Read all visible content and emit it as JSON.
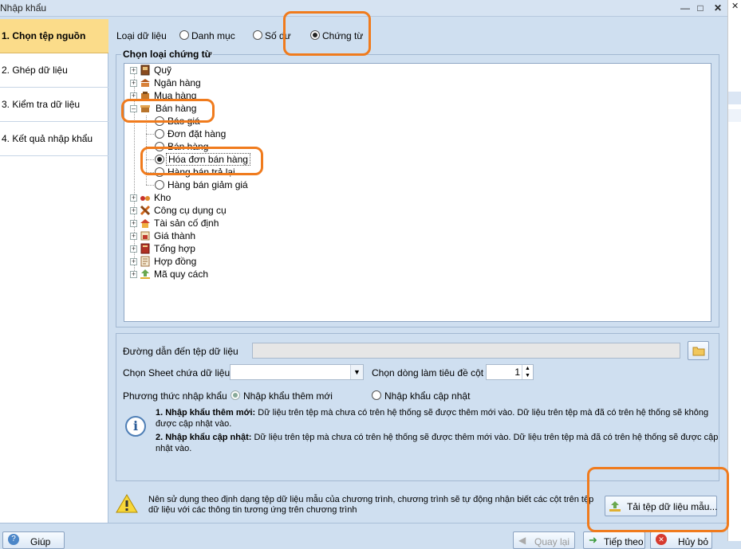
{
  "window": {
    "title": "Nhập khẩu"
  },
  "steps": [
    "1. Chọn tệp nguồn",
    "2. Ghép dữ liệu",
    "3. Kiểm tra dữ liệu",
    "4. Kết quả nhập khẩu"
  ],
  "data_type": {
    "label": "Loại dữ liệu",
    "options": [
      {
        "label": "Danh mục",
        "checked": false
      },
      {
        "label": "Số dư",
        "checked": false
      },
      {
        "label": "Chứng từ",
        "checked": true
      }
    ]
  },
  "voucher_group": {
    "title": "Chọn loại chứng từ",
    "tree": [
      {
        "label": "Quỹ",
        "icon": "cashbox-icon"
      },
      {
        "label": "Ngân hàng",
        "icon": "bank-icon"
      },
      {
        "label": "Mua hàng",
        "icon": "purchase-icon"
      },
      {
        "label": "Bán hàng",
        "icon": "sales-icon",
        "expanded": true,
        "children": [
          {
            "label": "Báo giá",
            "checked": false
          },
          {
            "label": "Đơn đặt hàng",
            "checked": false
          },
          {
            "label": "Bán hàng",
            "checked": false
          },
          {
            "label": "Hóa đơn bán hàng",
            "checked": true
          },
          {
            "label": "Hàng bán trả lại",
            "checked": false
          },
          {
            "label": "Hàng bán giảm giá",
            "checked": false
          }
        ]
      },
      {
        "label": "Kho",
        "icon": "warehouse-icon"
      },
      {
        "label": "Công cụ dụng cụ",
        "icon": "tools-icon"
      },
      {
        "label": "Tài sản cố định",
        "icon": "fixed-asset-icon"
      },
      {
        "label": "Giá thành",
        "icon": "cost-icon"
      },
      {
        "label": "Tổng hợp",
        "icon": "summary-book-icon"
      },
      {
        "label": "Hợp đồng",
        "icon": "contract-icon"
      },
      {
        "label": "Mã quy cách",
        "icon": "spec-code-icon"
      }
    ]
  },
  "file": {
    "path_label": "Đường dẫn đến tệp dữ liệu",
    "path_value": "",
    "sheet_label": "Chọn Sheet chứa dữ liệu",
    "sheet_value": "",
    "header_row_label": "Chọn dòng làm tiêu đề cột",
    "header_row_value": "1"
  },
  "import_method": {
    "label": "Phương thức nhập khẩu",
    "options": [
      {
        "label": "Nhập khẩu thêm mới",
        "checked": true,
        "disabled": true
      },
      {
        "label": "Nhập khẩu cập nhật",
        "checked": false
      }
    ],
    "note1_title": "1. Nhập khẩu thêm mới:",
    "note1_text": "Dữ liệu trên tệp mà chưa có trên hệ thống sẽ được thêm mới vào. Dữ liệu trên tệp mà đã có trên hệ thống sẽ không",
    "note1_text2": "được cập nhật vào.",
    "note2_title": "2. Nhập khẩu cập nhật:",
    "note2_text": "Dữ liệu trên tệp mà chưa có trên hệ thống sẽ được thêm mới vào. Dữ liệu trên tệp mà đã có trên hệ thống sẽ được cập",
    "note2_text2": "nhật vào."
  },
  "hint": {
    "line1": "Nên sử dụng theo định dạng tệp dữ liệu mẫu của chương trình, chương trình sẽ tự động nhận biết các cột trên tệp",
    "line2": "dữ liệu với các thông tin tương ứng trên chương trình"
  },
  "buttons": {
    "download_template": "Tải tệp dữ liệu mẫu...",
    "help": "Giúp",
    "back": "Quay lại",
    "next": "Tiếp theo",
    "cancel": "Hủy bỏ"
  },
  "colors": {
    "highlight": "#f07b1d",
    "active_step": "#fbdc8a",
    "panel": "#cfdff0"
  }
}
